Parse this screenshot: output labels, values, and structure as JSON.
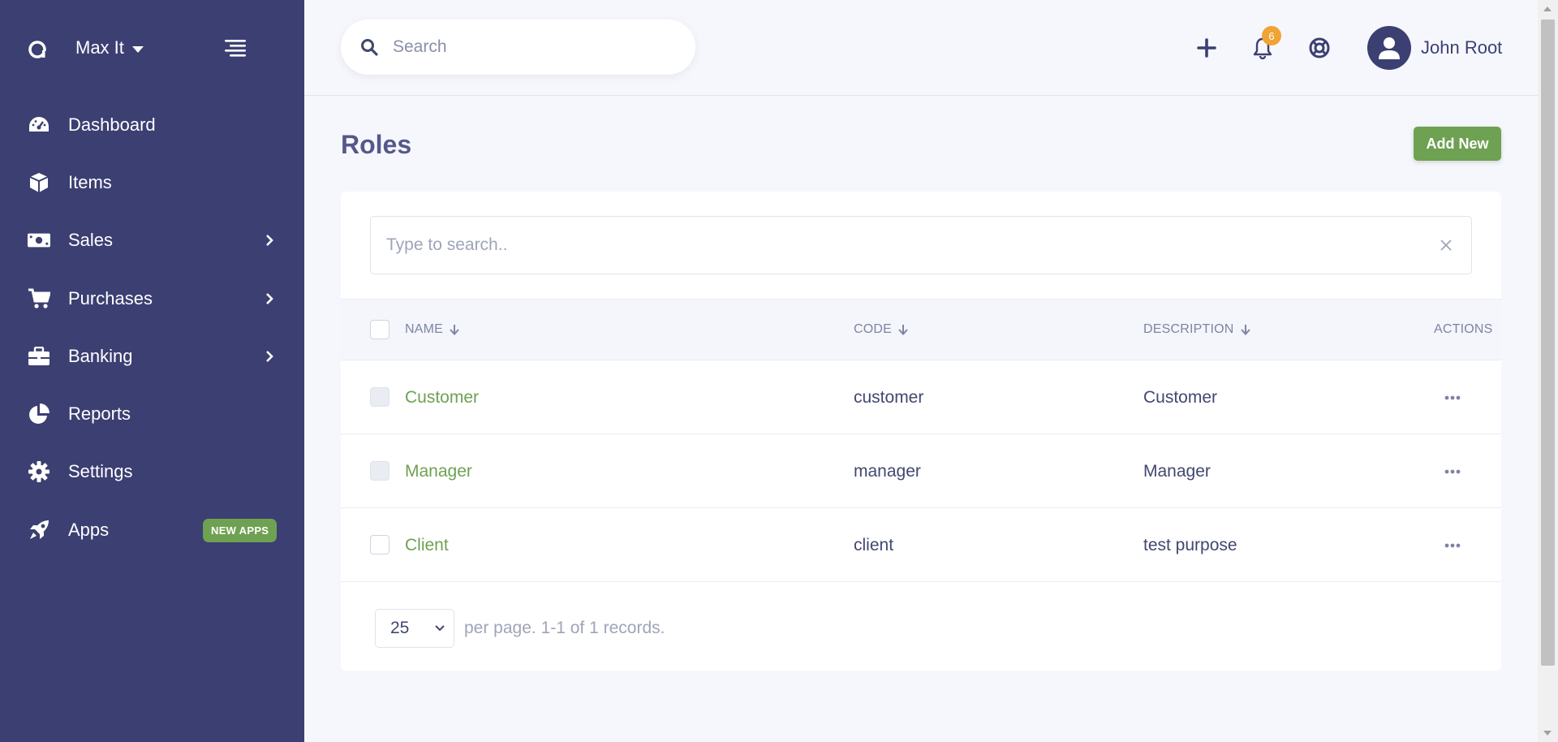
{
  "sidebar": {
    "company": "Max It",
    "items": [
      {
        "label": "Dashboard",
        "icon": "dashboard-icon"
      },
      {
        "label": "Items",
        "icon": "box-icon"
      },
      {
        "label": "Sales",
        "icon": "money-icon",
        "has_children": true
      },
      {
        "label": "Purchases",
        "icon": "cart-icon",
        "has_children": true
      },
      {
        "label": "Banking",
        "icon": "briefcase-icon",
        "has_children": true
      },
      {
        "label": "Reports",
        "icon": "pie-chart-icon"
      },
      {
        "label": "Settings",
        "icon": "gear-icon"
      },
      {
        "label": "Apps",
        "icon": "rocket-icon",
        "badge": "NEW APPS"
      }
    ],
    "colors": {
      "background": "#3c3f72",
      "badge": "#6ea152"
    }
  },
  "header": {
    "search_placeholder": "Search",
    "notification_count": "6",
    "user_name": "John Root",
    "icons": [
      "plus-icon",
      "bell-icon",
      "help-icon",
      "user-icon"
    ]
  },
  "main": {
    "title": "Roles",
    "add_button": "Add New",
    "table_search_placeholder": "Type to search..",
    "columns": {
      "name": "NAME",
      "code": "CODE",
      "description": "DESCRIPTION",
      "actions": "ACTIONS"
    },
    "rows": [
      {
        "name": "Customer",
        "code": "customer",
        "description": "Customer",
        "checkbox_disabled": true
      },
      {
        "name": "Manager",
        "code": "manager",
        "description": "Manager",
        "checkbox_disabled": true
      },
      {
        "name": "Client",
        "code": "client",
        "description": "test purpose",
        "checkbox_disabled": false
      }
    ],
    "pagination": {
      "per_page": "25",
      "summary": "per page. 1-1 of 1 records."
    },
    "colors": {
      "accent": "#6ea152",
      "notification": "#f0a433"
    }
  }
}
